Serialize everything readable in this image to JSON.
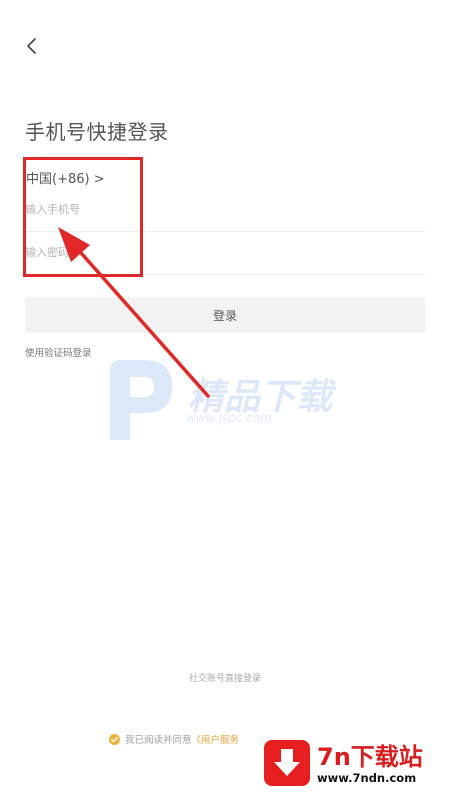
{
  "header": {
    "title": "手机号快捷登录"
  },
  "form": {
    "country_code": "中国(+86) >",
    "phone_placeholder": "输入手机号",
    "password_placeholder": "输入密码",
    "login_button": "登录",
    "sms_login_link": "使用验证码登录"
  },
  "footer": {
    "social_login": "社交账号直接登录",
    "agreement_prefix": "我已阅读并同意",
    "agreement_link": "《用户服务"
  },
  "watermark": {
    "title": "精品下载",
    "url": "www.jspc.com"
  },
  "badge": {
    "title": "7n下载站",
    "url": "www.7ndn.com"
  },
  "colors": {
    "accent": "#e8a33a",
    "annotation": "#e02828"
  }
}
